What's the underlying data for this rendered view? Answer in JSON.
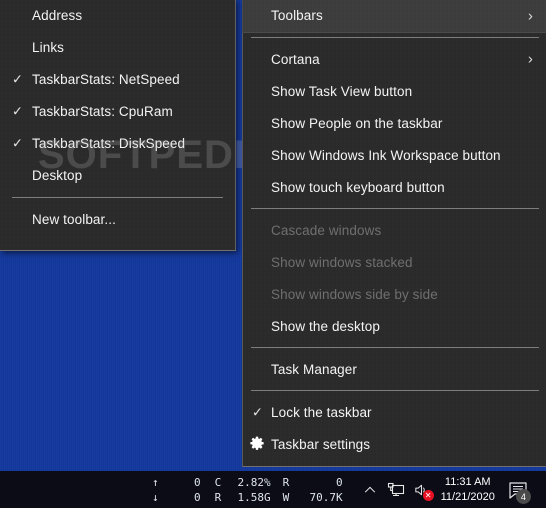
{
  "toolbars_submenu": {
    "title": "Toolbars",
    "items": [
      {
        "label": "Address",
        "checked": false
      },
      {
        "label": "Links",
        "checked": false
      },
      {
        "label": "TaskbarStats: NetSpeed",
        "checked": true
      },
      {
        "label": "TaskbarStats: CpuRam",
        "checked": true
      },
      {
        "label": "TaskbarStats: DiskSpeed",
        "checked": true
      },
      {
        "label": "Desktop",
        "checked": false
      }
    ],
    "footer_item": {
      "label": "New toolbar...",
      "checked": false
    }
  },
  "context_menu": {
    "groups": [
      {
        "items": [
          {
            "label": "Toolbars",
            "submenu": true,
            "highlighted": true,
            "disabled": false,
            "checked": false,
            "icon": ""
          }
        ]
      },
      {
        "items": [
          {
            "label": "Cortana",
            "submenu": true,
            "highlighted": false,
            "disabled": false,
            "checked": false,
            "icon": ""
          },
          {
            "label": "Show Task View button",
            "submenu": false,
            "highlighted": false,
            "disabled": false,
            "checked": false,
            "icon": ""
          },
          {
            "label": "Show People on the taskbar",
            "submenu": false,
            "highlighted": false,
            "disabled": false,
            "checked": false,
            "icon": ""
          },
          {
            "label": "Show Windows Ink Workspace button",
            "submenu": false,
            "highlighted": false,
            "disabled": false,
            "checked": false,
            "icon": ""
          },
          {
            "label": "Show touch keyboard button",
            "submenu": false,
            "highlighted": false,
            "disabled": false,
            "checked": false,
            "icon": ""
          }
        ]
      },
      {
        "items": [
          {
            "label": "Cascade windows",
            "submenu": false,
            "highlighted": false,
            "disabled": true,
            "checked": false,
            "icon": ""
          },
          {
            "label": "Show windows stacked",
            "submenu": false,
            "highlighted": false,
            "disabled": true,
            "checked": false,
            "icon": ""
          },
          {
            "label": "Show windows side by side",
            "submenu": false,
            "highlighted": false,
            "disabled": true,
            "checked": false,
            "icon": ""
          },
          {
            "label": "Show the desktop",
            "submenu": false,
            "highlighted": false,
            "disabled": false,
            "checked": false,
            "icon": ""
          }
        ]
      },
      {
        "items": [
          {
            "label": "Task Manager",
            "submenu": false,
            "highlighted": false,
            "disabled": false,
            "checked": false,
            "icon": ""
          }
        ]
      },
      {
        "items": [
          {
            "label": "Lock the taskbar",
            "submenu": false,
            "highlighted": false,
            "disabled": false,
            "checked": true,
            "icon": ""
          },
          {
            "label": "Taskbar settings",
            "submenu": false,
            "highlighted": false,
            "disabled": false,
            "checked": false,
            "icon": "gear-icon"
          }
        ]
      }
    ],
    "submenu_glyph": "›",
    "check_glyph": "✓"
  },
  "watermark": {
    "text": "SOFTPEDIA",
    "mark": "®"
  },
  "taskbar": {
    "stats": {
      "netspeed": {
        "up_arrow": "↑",
        "up_value": "0",
        "down_arrow": "↓",
        "down_value": "0"
      },
      "cpuram": {
        "cpu_label": "C",
        "cpu_value": "2.82%",
        "ram_label": "R",
        "ram_value": "1.58G"
      },
      "diskspeed": {
        "read_label": "R",
        "read_value": "0",
        "write_label": "W",
        "write_value": "70.7K"
      }
    },
    "tray": {
      "overflow_icon": "chevron-up-icon",
      "network_icon": "network-icon",
      "volume_icon": "volume-muted-icon",
      "time": "11:31 AM",
      "date": "11/21/2020",
      "notifications_icon": "action-center-icon",
      "notifications_count": "4"
    }
  },
  "colors": {
    "menu_bg": "#2b2b2b",
    "menu_highlight": "#3d3d3d",
    "text": "#f4f4f4",
    "text_disabled": "#6f6f6f",
    "desktop": "#13389c",
    "taskbar_bg": "#0b0c16",
    "badge_bg": "#4a4a4a",
    "mute_badge": "#e81123"
  }
}
